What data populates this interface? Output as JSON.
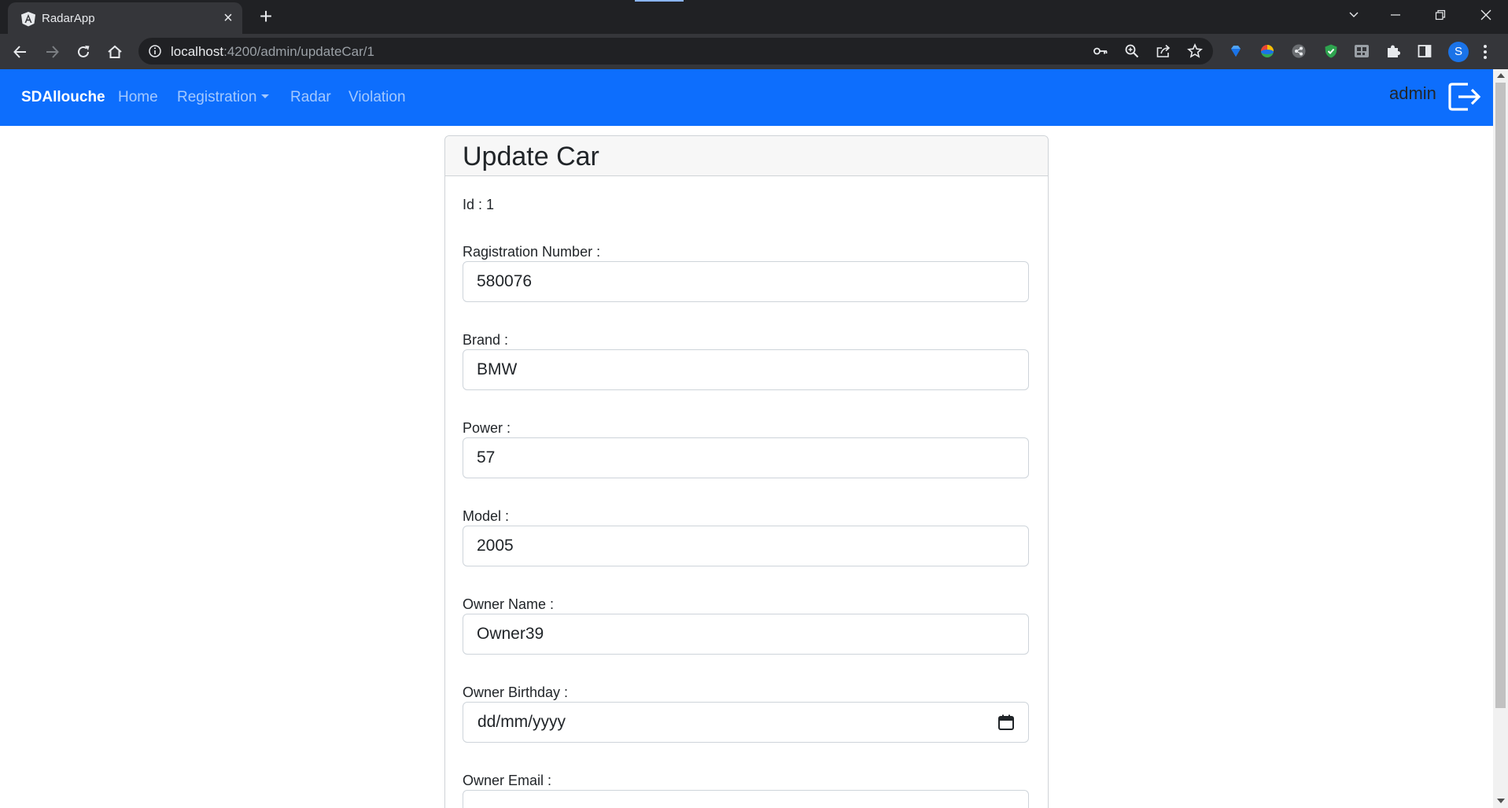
{
  "browser": {
    "tab_title": "RadarApp",
    "url_host": "localhost",
    "url_path": ":4200/admin/updateCar/1",
    "profile_initial": "S"
  },
  "navbar": {
    "brand": "SDAllouche",
    "links": [
      "Home",
      "Registration",
      "Radar",
      "Violation"
    ],
    "user": "admin"
  },
  "card": {
    "title": "Update Car",
    "id_text": "Id : 1",
    "fields": [
      {
        "label": "Ragistration Number :",
        "value": "580076"
      },
      {
        "label": "Brand :",
        "value": "BMW"
      },
      {
        "label": "Power :",
        "value": "57"
      },
      {
        "label": "Model :",
        "value": "2005"
      },
      {
        "label": "Owner Name :",
        "value": "Owner39"
      },
      {
        "label": "Owner Birthday :",
        "value": "dd/mm/yyyy"
      },
      {
        "label": "Owner Email :",
        "value": ""
      }
    ]
  },
  "colors": {
    "navbar": "#0d6efd",
    "chrome_dark": "#202124",
    "chrome_toolbar": "#35363a"
  },
  "icons": [
    "angular-icon",
    "close-icon",
    "plus-icon",
    "back-icon",
    "forward-icon",
    "reload-icon",
    "home-icon",
    "info-icon",
    "key-icon",
    "zoom-icon",
    "share-icon",
    "star-icon",
    "extension-gem-icon",
    "extension-colorful-icon",
    "extension-gray-icon",
    "extension-shield-icon",
    "extension-qr-icon",
    "puzzle-icon",
    "sidepanel-icon",
    "menu-icon",
    "logout-icon",
    "calendar-icon"
  ]
}
